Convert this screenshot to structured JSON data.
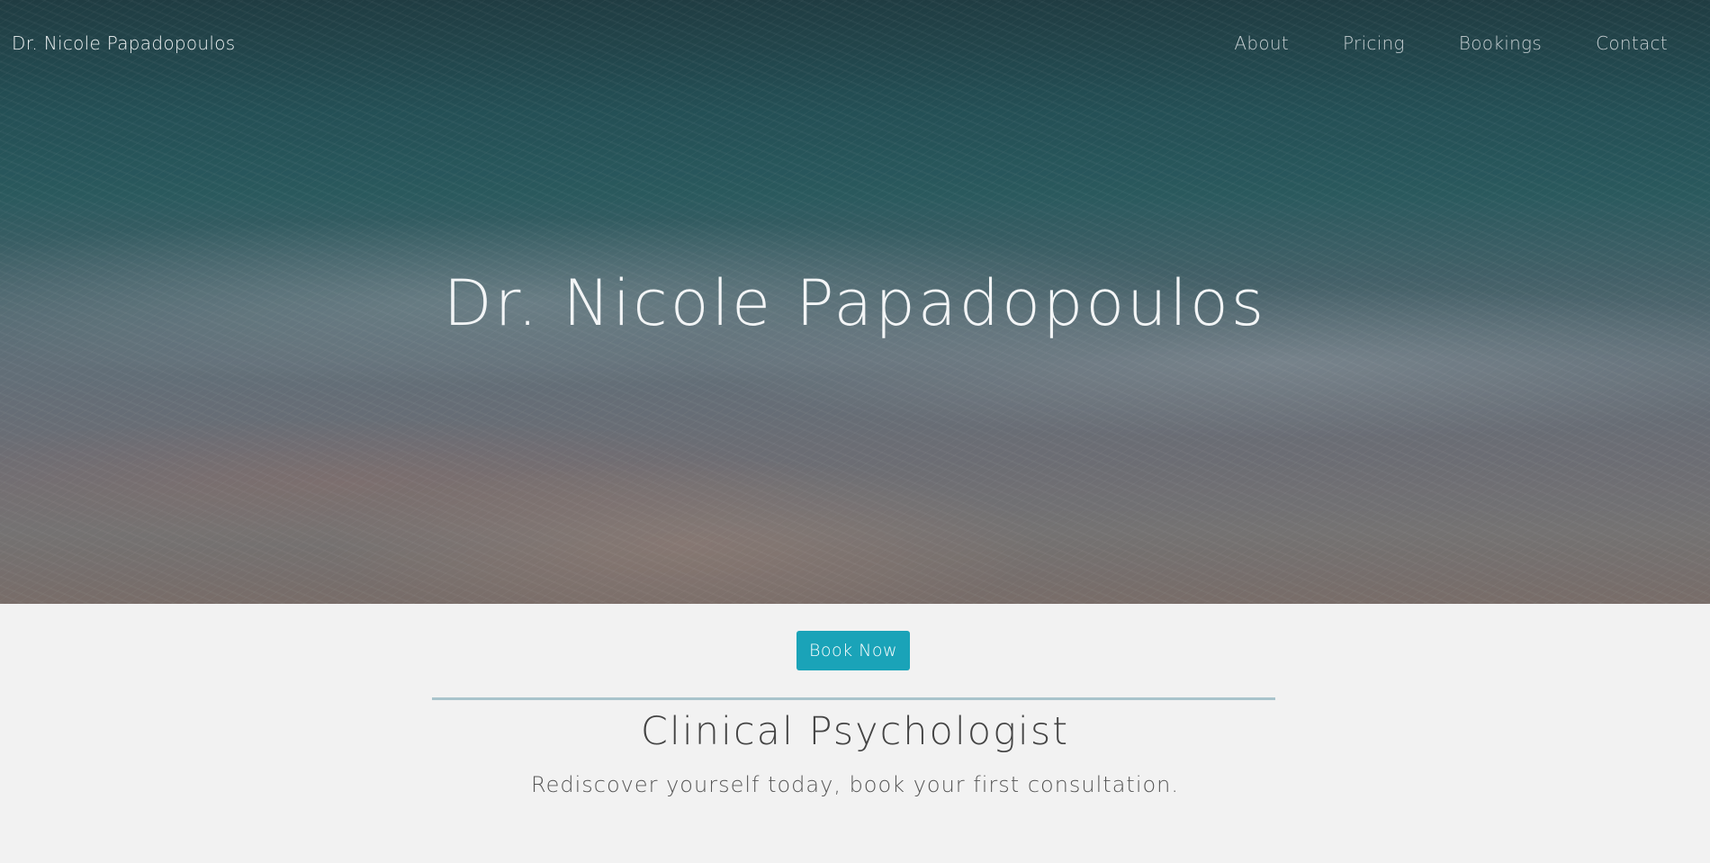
{
  "header": {
    "brand": "Dr. Nicole Papadopoulos",
    "nav": [
      {
        "label": "About"
      },
      {
        "label": "Pricing"
      },
      {
        "label": "Bookings"
      },
      {
        "label": "Contact"
      }
    ]
  },
  "hero": {
    "title": "Dr. Nicole Papadopoulos"
  },
  "main": {
    "cta_label": "Book Now",
    "subtitle": "Clinical Psychologist",
    "tagline": "Rediscover yourself today, book your first consultation."
  },
  "colors": {
    "accent": "#1aa3b8",
    "divider": "#a9c4cc",
    "background": "#f2f2f2"
  }
}
